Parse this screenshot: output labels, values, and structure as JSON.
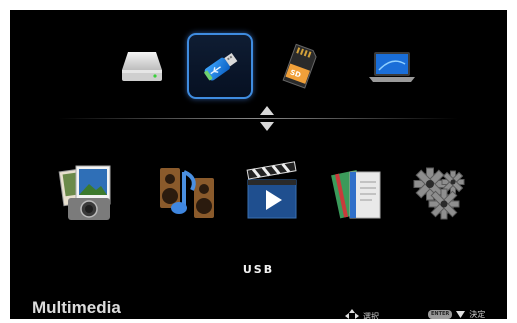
{
  "sources": [
    {
      "id": "hdd",
      "icon": "hard-drive-icon",
      "selected": false
    },
    {
      "id": "usb",
      "icon": "usb-drive-icon",
      "selected": true
    },
    {
      "id": "sd",
      "icon": "sd-card-icon",
      "selected": false
    },
    {
      "id": "network",
      "icon": "laptop-network-icon",
      "selected": false
    }
  ],
  "categories": [
    {
      "id": "photo",
      "icon": "photo-icon"
    },
    {
      "id": "music",
      "icon": "music-icon"
    },
    {
      "id": "video",
      "icon": "video-icon"
    },
    {
      "id": "documents",
      "icon": "documents-icon"
    },
    {
      "id": "settings",
      "icon": "settings-gear-icon"
    }
  ],
  "selected_source_label": "USB",
  "footer": {
    "title": "Multimedia",
    "select_hint": "選択",
    "enter_key_label": "ENTER",
    "confirm_hint": "決定"
  },
  "colors": {
    "background": "#000000",
    "selection_border": "#3f8ce0",
    "frame": "#ffffff"
  }
}
